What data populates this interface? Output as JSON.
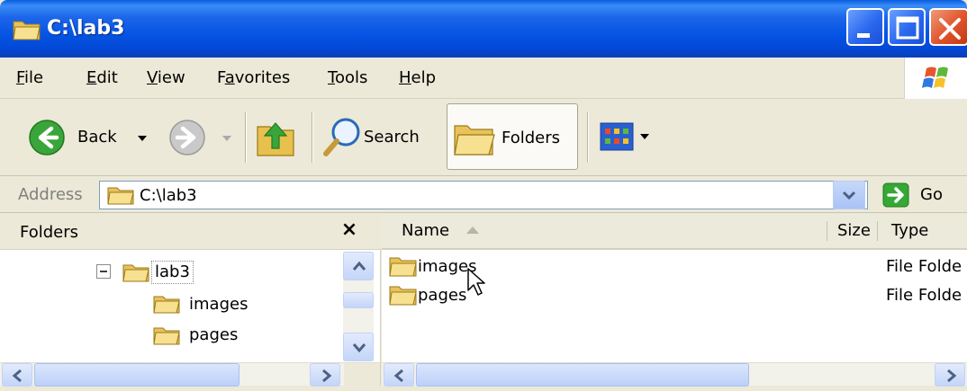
{
  "window": {
    "title": "C:\\lab3",
    "controls": {
      "minimize": "minimize",
      "maximize": "maximize",
      "close": "close"
    }
  },
  "menu": {
    "items": [
      {
        "label_ul": "F",
        "label_rest": "ile"
      },
      {
        "label_ul": "E",
        "label_rest": "dit"
      },
      {
        "label_ul": "V",
        "label_rest": "iew"
      },
      {
        "label_pre": "F",
        "label_ul": "a",
        "label_rest": "vorites"
      },
      {
        "label_ul": "T",
        "label_rest": "ools"
      },
      {
        "label_ul": "H",
        "label_rest": "elp"
      }
    ]
  },
  "toolbar": {
    "back_label": "Back",
    "search_label": "Search",
    "folders_label": "Folders"
  },
  "address": {
    "label": "Address",
    "value": "C:\\lab3",
    "go_label": "Go"
  },
  "folders_pane": {
    "title": "Folders",
    "close_glyph": "×",
    "tree": [
      {
        "label": "lab3",
        "expander": "minus",
        "selected": true
      },
      {
        "label": "images"
      },
      {
        "label": "pages"
      }
    ]
  },
  "list": {
    "columns": {
      "name": "Name",
      "size": "Size",
      "type": "Type"
    },
    "sort": "ascending",
    "rows": [
      {
        "name": "images",
        "size": "",
        "type": "File Folde"
      },
      {
        "name": "pages",
        "size": "",
        "type": "File Folde"
      }
    ]
  },
  "colors": {
    "titlebar": "#0554e3",
    "chrome": "#ece9d8",
    "folder": "#f4d27a",
    "go_green": "#2fa32f"
  },
  "icons": [
    "folder-icon",
    "back-icon",
    "forward-icon",
    "up-icon",
    "search-icon",
    "views-icon",
    "go-icon",
    "windows-logo",
    "mouse-cursor"
  ]
}
